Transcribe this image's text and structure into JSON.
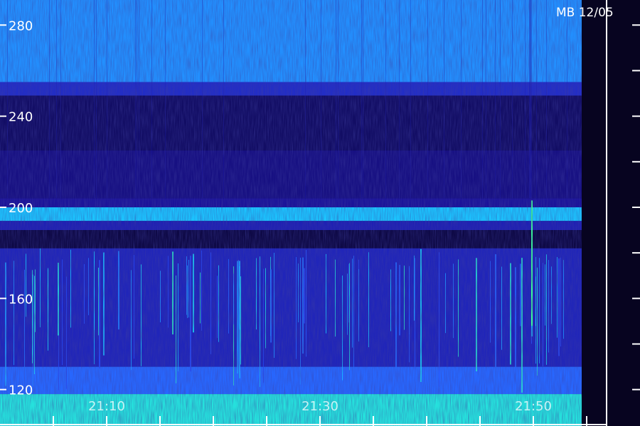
{
  "chart_data": {
    "type": "heatmap",
    "title": "MB 12/05",
    "xlabel": "",
    "ylabel": "",
    "x_tick_labels": [
      "21:10",
      "21:30",
      "21:50"
    ],
    "y_ticks": [
      120,
      160,
      200,
      240,
      280
    ],
    "ylim": [
      104,
      291
    ],
    "grid": false,
    "colors": {
      "background": "#0a0630",
      "low": "#1c14a0",
      "mid": "#2a52ff",
      "high": "#19d4ff",
      "peak": "#3cff9a",
      "axis": "#ffffff"
    },
    "bands": [
      {
        "y_from": 255,
        "y_to": 291,
        "level": 0.72
      },
      {
        "y_from": 249,
        "y_to": 255,
        "level": 0.42
      },
      {
        "y_from": 225,
        "y_to": 249,
        "level": 0.14
      },
      {
        "y_from": 204,
        "y_to": 225,
        "level": 0.22
      },
      {
        "y_from": 200,
        "y_to": 204,
        "level": 0.28
      },
      {
        "y_from": 194,
        "y_to": 200,
        "level": 0.82
      },
      {
        "y_from": 190,
        "y_to": 194,
        "level": 0.36
      },
      {
        "y_from": 182,
        "y_to": 190,
        "level": 0.06
      },
      {
        "y_from": 130,
        "y_to": 182,
        "level": 0.38
      },
      {
        "y_from": 118,
        "y_to": 130,
        "level": 0.64
      },
      {
        "y_from": 104,
        "y_to": 118,
        "level": 0.9
      }
    ]
  }
}
